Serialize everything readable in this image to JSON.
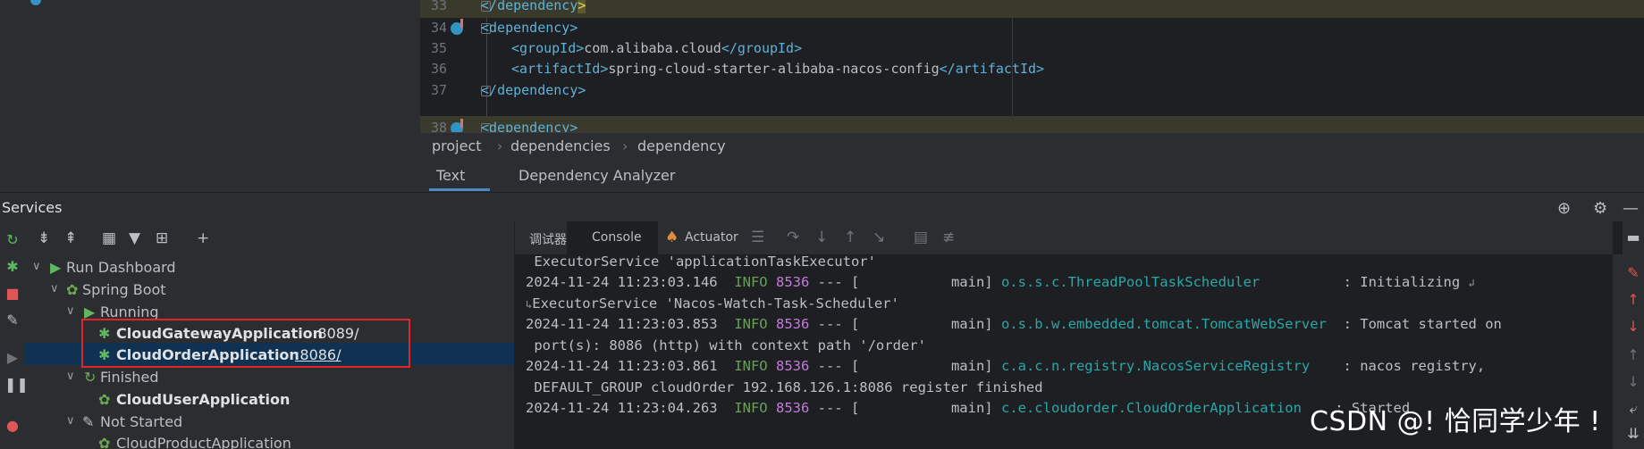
{
  "editor": {
    "lines": [
      {
        "num": "33",
        "open": "</",
        "tag": "dependency",
        "close": ">",
        "text": "",
        "selected": true
      },
      {
        "num": "34",
        "open": "<",
        "tag": "dependency",
        "close": ">",
        "text": ""
      },
      {
        "num": "35",
        "open": "<",
        "tag": "groupId",
        "close": ">",
        "text": "com.alibaba.cloud",
        "end_open": "</",
        "end_tag": "groupId",
        "end_close": ">"
      },
      {
        "num": "36",
        "open": "<",
        "tag": "artifactId",
        "close": ">",
        "text": "spring-cloud-starter-alibaba-nacos-config",
        "end_open": "</",
        "end_tag": "artifactId",
        "end_close": ">"
      },
      {
        "num": "37",
        "open": "</",
        "tag": "dependency",
        "close": ">",
        "text": ""
      },
      {
        "num": "38",
        "open": "<",
        "tag": "dependency",
        "close": ">",
        "text": ""
      }
    ]
  },
  "breadcrumb": [
    "project",
    "dependencies",
    "dependency"
  ],
  "editor_tabs": {
    "text": "Text",
    "analyzer": "Dependency Analyzer"
  },
  "services": {
    "title": "Services",
    "tree": {
      "run_dashboard": "Run Dashboard",
      "spring_boot": "Spring Boot",
      "running": "Running",
      "gateway_app": "CloudGatewayApplication",
      "gateway_port": ":8089/",
      "order_app": "CloudOrderApplication",
      "order_port": ":8086/",
      "finished": "Finished",
      "user_app": "CloudUserApplication",
      "not_started": "Not Started",
      "product_app": "CloudProductApplication"
    }
  },
  "console_tabs": {
    "debugger": "调试器",
    "console": "Console",
    "actuator": "Actuator"
  },
  "console": {
    "l1": " ExecutorService 'applicationTaskExecutor'",
    "l2": {
      "ts": "2024-11-24 11:23:03.146",
      "level": "INFO",
      "pid": "8536",
      "mid": " --- [           main] ",
      "logger": "o.s.s.c.ThreadPoolTaskScheduler",
      "msg": "          : Initializing "
    },
    "l3": "ExecutorService 'Nacos-Watch-Task-Scheduler'",
    "l4": {
      "ts": "2024-11-24 11:23:03.853",
      "level": "INFO",
      "pid": "8536",
      "mid": " --- [           main] ",
      "logger": "o.s.b.w.embedded.tomcat.TomcatWebServer",
      "msg": "  : Tomcat started on"
    },
    "l5": " port(s): 8086 (http) with context path '/order'",
    "l6": {
      "ts": "2024-11-24 11:23:03.861",
      "level": "INFO",
      "pid": "8536",
      "mid": " --- [           main] ",
      "logger": "c.a.c.n.registry.NacosServiceRegistry",
      "msg": "    : nacos registry,"
    },
    "l7": " DEFAULT_GROUP cloudOrder 192.168.126.1:8086 register finished",
    "l8": {
      "ts": "2024-11-24 11:23:04.263",
      "level": "INFO",
      "pid": "8536",
      "mid": " --- [           main] ",
      "logger": "c.e.cloudorder.CloudOrderApplication",
      "msg": "    : Started"
    }
  },
  "watermark": "CSDN @! 恰同学少年 !",
  "colors": {
    "accent": "#4a88c7",
    "highlight_box": "#e0242b",
    "selection": "#0f3252",
    "info": "#6a9e5a",
    "logger": "#2aa7a6"
  }
}
